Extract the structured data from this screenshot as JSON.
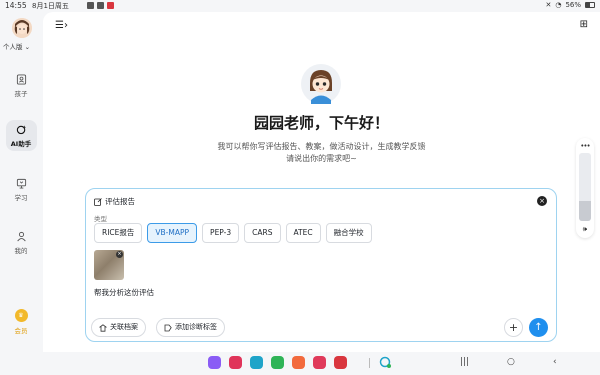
{
  "status_bar": {
    "time": "14:55",
    "date": "8月1日周五",
    "battery": "56%"
  },
  "sidebar": {
    "edition": "个人版",
    "items": [
      {
        "label": "孩子",
        "icon": "child-profile-icon"
      },
      {
        "label": "AI助手",
        "icon": "ai-assistant-icon"
      },
      {
        "label": "学习",
        "icon": "learning-icon"
      },
      {
        "label": "我的",
        "icon": "user-icon"
      }
    ],
    "vip_label": "会员"
  },
  "main": {
    "greeting": "园园老师，下午好！",
    "subtitle_line1": "我可以帮你写评估报告、教案，做活动设计，生成教学反馈",
    "subtitle_line2": "请说出你的需求吧~"
  },
  "composer": {
    "mode_title": "评估报告",
    "type_label": "类型",
    "types": [
      "RICE报告",
      "VB-MAPP",
      "PEP-3",
      "CARS",
      "ATEC",
      "融合学校"
    ],
    "selected_type": "VB-MAPP",
    "prompt_text": "帮我分析这份评估",
    "link_profile_label": "关联档案",
    "add_tag_label": "添加诊断标签"
  },
  "volume_level": 0.3,
  "colors": {
    "accent": "#1f8fee",
    "selected_chip_bg": "#e6f3fd",
    "vip": "#f2b92b"
  }
}
